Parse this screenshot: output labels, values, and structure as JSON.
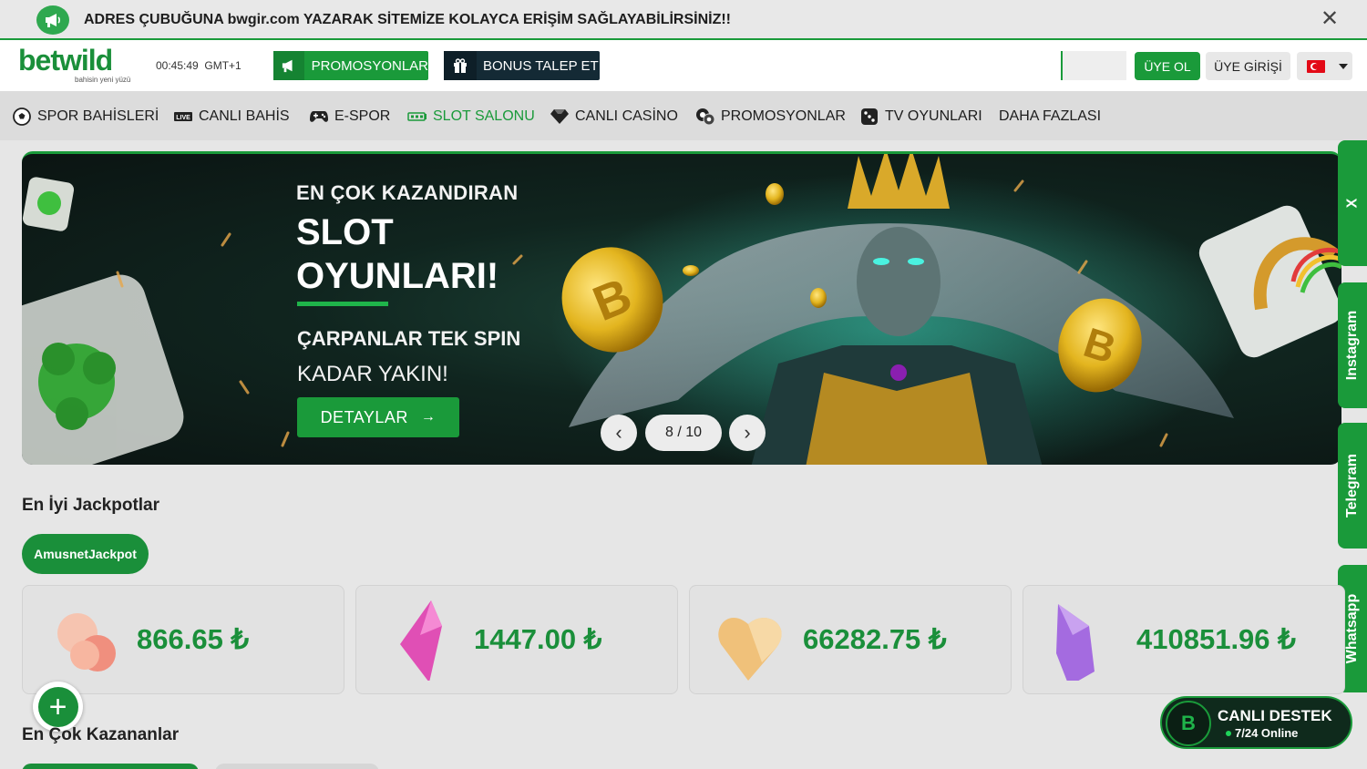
{
  "notice": {
    "text_before": "ADRES ÇUBUĞUNA",
    "url": "bwgir.com",
    "text_after": "YAZARAK SİTEMİZE KOLAYCA ERİŞİM SAĞLAYABİLİRSİNİZ!!",
    "close": "✕"
  },
  "header": {
    "logo": "betwild",
    "logo_tagline": "bahisin yeni yüzü",
    "time": "00:45:49",
    "timezone": "GMT+1",
    "promo_label": "PROMOSYONLAR",
    "bonus_label": "BONUS TALEP ET",
    "register_label": "ÜYE OL",
    "login_label": "ÜYE GİRİŞİ"
  },
  "nav": [
    {
      "label": "SPOR BAHİSLERİ",
      "icon": "soccer-ball-icon"
    },
    {
      "label": "CANLI BAHİS",
      "icon": "live-icon"
    },
    {
      "label": "E-SPOR",
      "icon": "gamepad-icon"
    },
    {
      "label": "SLOT SALONU",
      "icon": "slot-icon"
    },
    {
      "label": "CANLI CASİNO",
      "icon": "diamond-icon"
    },
    {
      "label": "PROMOSYONLAR",
      "icon": "chips-icon"
    },
    {
      "label": "TV OYUNLARI",
      "icon": "dice-icon"
    },
    {
      "label": "DAHA FAZLASI",
      "icon": ""
    }
  ],
  "banner": {
    "eyebrow": "EN ÇOK KAZANDIRAN",
    "title_line1": "SLOT",
    "title_line2": "OYUNLARI!",
    "sub_line1": "ÇARPANLAR TEK SPIN",
    "sub_line2": "KADAR YAKIN!",
    "cta": "DETAYLAR",
    "cta_arrow": "→",
    "counter": "8 / 10",
    "prev": "‹",
    "next": "›"
  },
  "social": {
    "close": "X",
    "instagram": "Instagram",
    "telegram": "Telegram",
    "whatsapp": "Whatsapp"
  },
  "jackpots": {
    "title": "En İyi Jackpotlar",
    "provider": "AmusnetJackpot",
    "cards": [
      {
        "amount": "866.65 ₺",
        "gem": "hearts-gem"
      },
      {
        "amount": "1447.00 ₺",
        "gem": "pink-crystal-gem"
      },
      {
        "amount": "66282.75 ₺",
        "gem": "gold-heart-gem"
      },
      {
        "amount": "410851.96 ₺",
        "gem": "purple-crystal-gem"
      }
    ]
  },
  "winners": {
    "title": "En Çok Kazananlar"
  },
  "fab": "+",
  "live_support": {
    "title": "CANLI DESTEK",
    "status": "7/24 Online",
    "logo": "B"
  },
  "colors": {
    "brand_green": "#1a9a3a",
    "dark_navy": "#142a35",
    "page_bg": "#e6e6e6"
  }
}
